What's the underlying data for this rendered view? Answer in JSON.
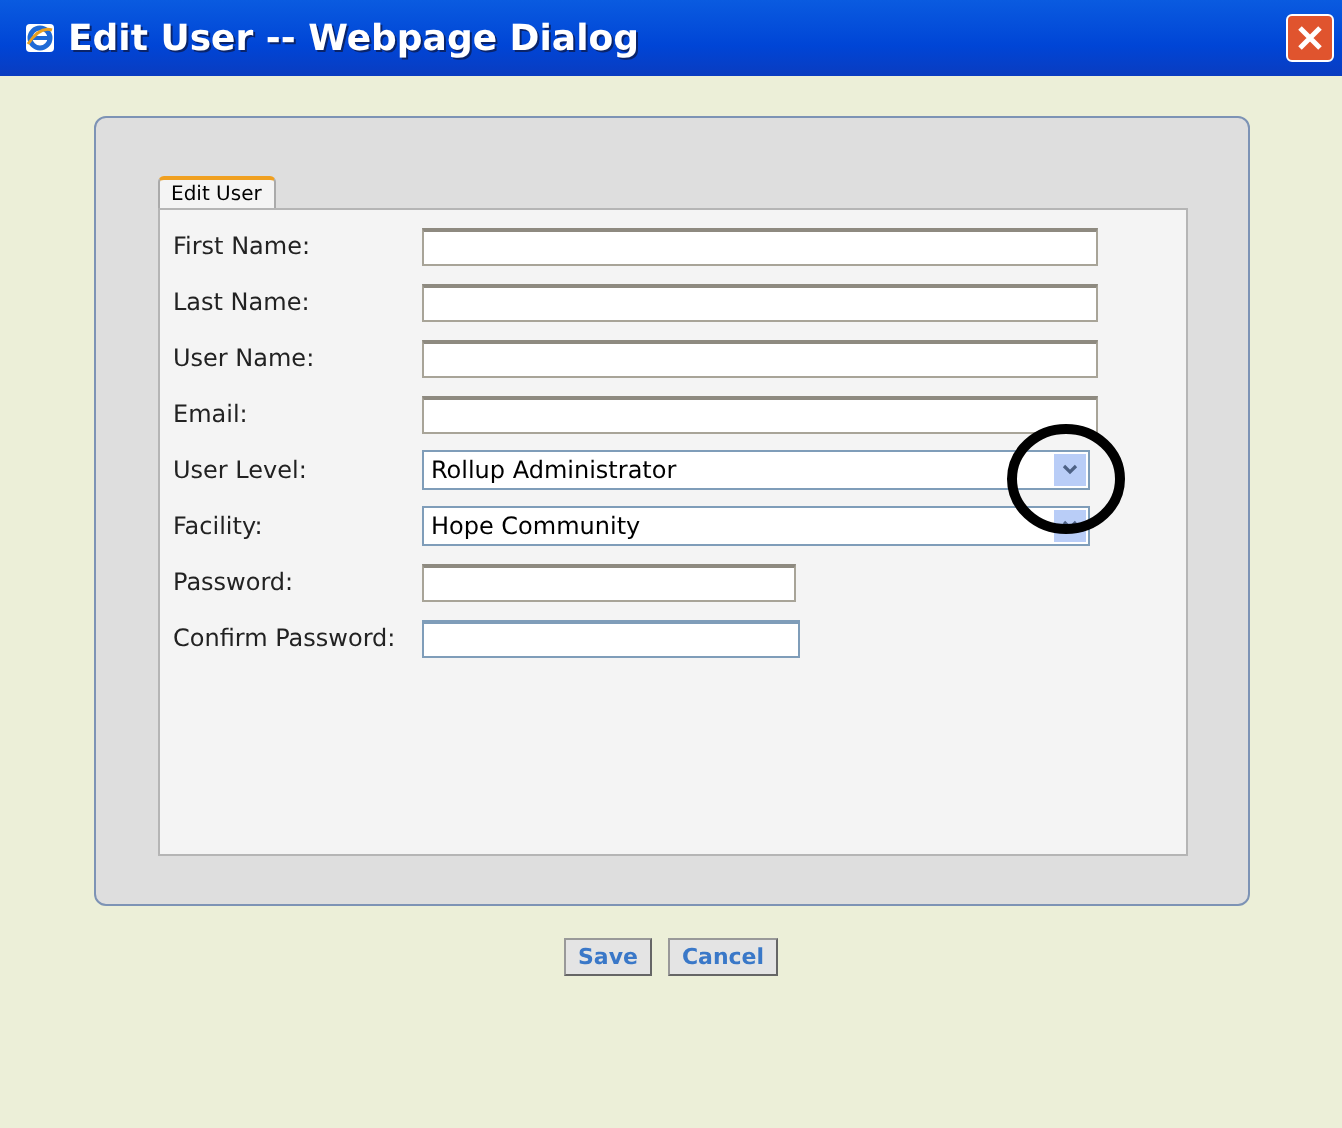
{
  "window": {
    "title": "Edit User -- Webpage Dialog"
  },
  "tabs": [
    {
      "label": "Edit User",
      "selected": true
    }
  ],
  "fields": [
    {
      "label": "First Name:",
      "kind": "text"
    },
    {
      "label": "Last Name:",
      "kind": "text"
    },
    {
      "label": "User Name:",
      "kind": "text"
    },
    {
      "label": "Email:",
      "kind": "text"
    },
    {
      "label": "User Level:",
      "kind": "select",
      "value": "Rollup Administrator"
    },
    {
      "label": "Facility:",
      "kind": "select",
      "value": "Hope Community"
    },
    {
      "label": "Password:",
      "kind": "password"
    },
    {
      "label": "Confirm Password:",
      "kind": "password"
    }
  ],
  "buttons": [
    "Save",
    "Cancel"
  ]
}
